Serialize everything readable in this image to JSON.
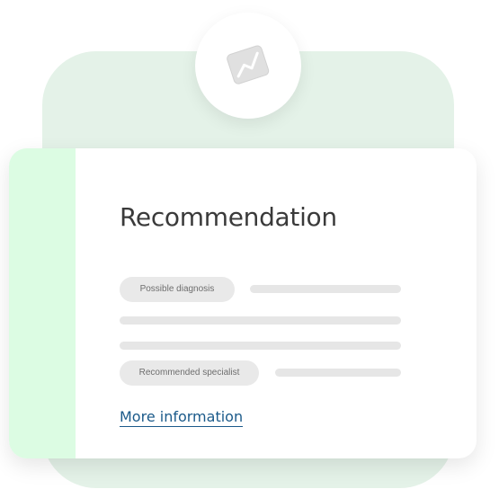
{
  "card": {
    "title": "Recommendation",
    "chips": {
      "diagnosis": "Possible diagnosis",
      "specialist": "Recommended specialist"
    },
    "link_label": "More information"
  },
  "icons": {
    "header_icon": "chart-trend-icon"
  },
  "colors": {
    "background_panel": "#e4f2e8",
    "card_accent": "#dcfce3",
    "link": "#1b5a8a"
  }
}
